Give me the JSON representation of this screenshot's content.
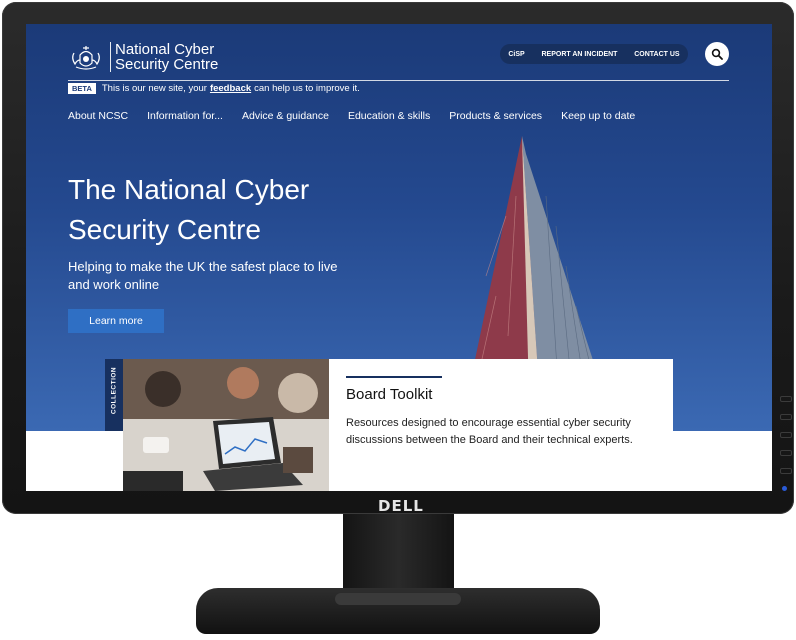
{
  "monitor": {
    "brand": "DELL"
  },
  "site": {
    "name_line1": "National Cyber",
    "name_line2": "Security Centre",
    "utility_links": [
      "CiSP",
      "REPORT AN INCIDENT",
      "CONTACT US"
    ],
    "beta": {
      "badge": "BETA",
      "text_before": "This is our new site, your",
      "link": "feedback",
      "text_after": "can help us to improve it."
    },
    "nav": [
      "About NCSC",
      "Information for...",
      "Advice & guidance",
      "Education & skills",
      "Products & services",
      "Keep up to date"
    ],
    "hero": {
      "title": "The National Cyber Security Centre",
      "subtitle": "Helping to make the UK the safest place to live and work online",
      "button": "Learn more"
    },
    "card": {
      "tag": "COLLECTION",
      "title": "Board Toolkit",
      "description": "Resources designed to encourage essential cyber security discussions between the Board and their technical experts."
    }
  },
  "icons": {
    "search": "search-icon",
    "crest": "royal-crest-icon"
  },
  "colors": {
    "hero": "#1b3a78",
    "accent_button": "#2f6fc4",
    "pill": "#17305f"
  }
}
